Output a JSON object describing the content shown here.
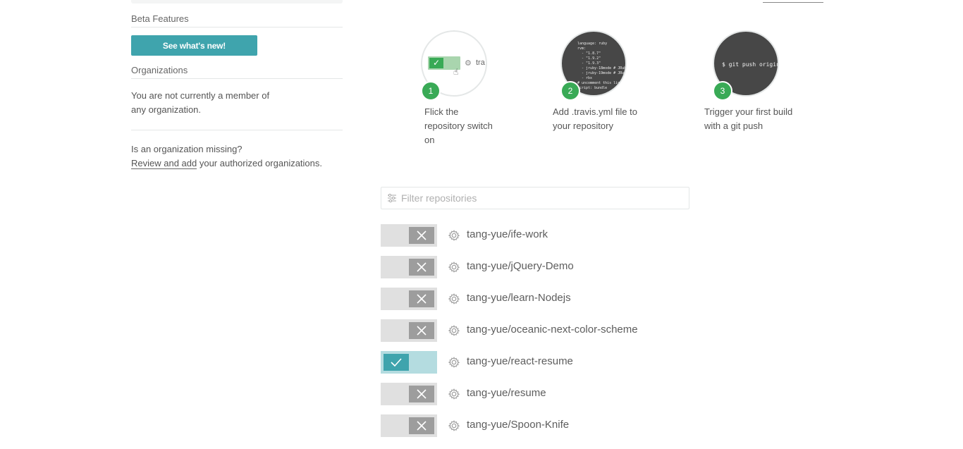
{
  "sidebar": {
    "beta_title": "Beta Features",
    "beta_button": "See what's new!",
    "org_title": "Organizations",
    "org_text_line1": "You are not currently a member of",
    "org_text_line2": "any organization.",
    "missing_question": "Is an organization missing?",
    "review_link": "Review and add",
    "review_suffix": " your authorized organizations."
  },
  "steps": [
    {
      "number": "1",
      "text_line1": "Flick the",
      "text_line2": "repository switch",
      "text_line3": "on",
      "illustration_label": "tra"
    },
    {
      "number": "2",
      "text_line1": "Add .travis.yml file to",
      "text_line2": "your repository",
      "code": "language: ruby\nrvm:\n  - \"1.8.7\"\n  - \"1.9.2\"\n  - \"1.9.3\"\n  - jruby-18mode # JRuby\n  - jruby-19mode # JRuby\n  - rbx\n# uncomment this line\nscript: bundle"
    },
    {
      "number": "3",
      "text_line1": "Trigger your first build",
      "text_line2": "with a git push",
      "command": "$ git push origin"
    }
  ],
  "filter": {
    "placeholder": "Filter repositories"
  },
  "repos": [
    {
      "name": "tang-yue/ife-work",
      "enabled": false
    },
    {
      "name": "tang-yue/jQuery-Demo",
      "enabled": false
    },
    {
      "name": "tang-yue/learn-Nodejs",
      "enabled": false
    },
    {
      "name": "tang-yue/oceanic-next-color-scheme",
      "enabled": false
    },
    {
      "name": "tang-yue/react-resume",
      "enabled": true
    },
    {
      "name": "tang-yue/resume",
      "enabled": false
    },
    {
      "name": "tang-yue/Spoon-Knife",
      "enabled": false
    }
  ],
  "colors": {
    "accent_teal": "#3fa4ad",
    "step_green": "#39aa56",
    "switch_off": "#9d9d9d"
  },
  "icons": {
    "gear": "gear-icon",
    "check": "check-icon",
    "close": "close-icon",
    "filter": "filter-icon"
  }
}
